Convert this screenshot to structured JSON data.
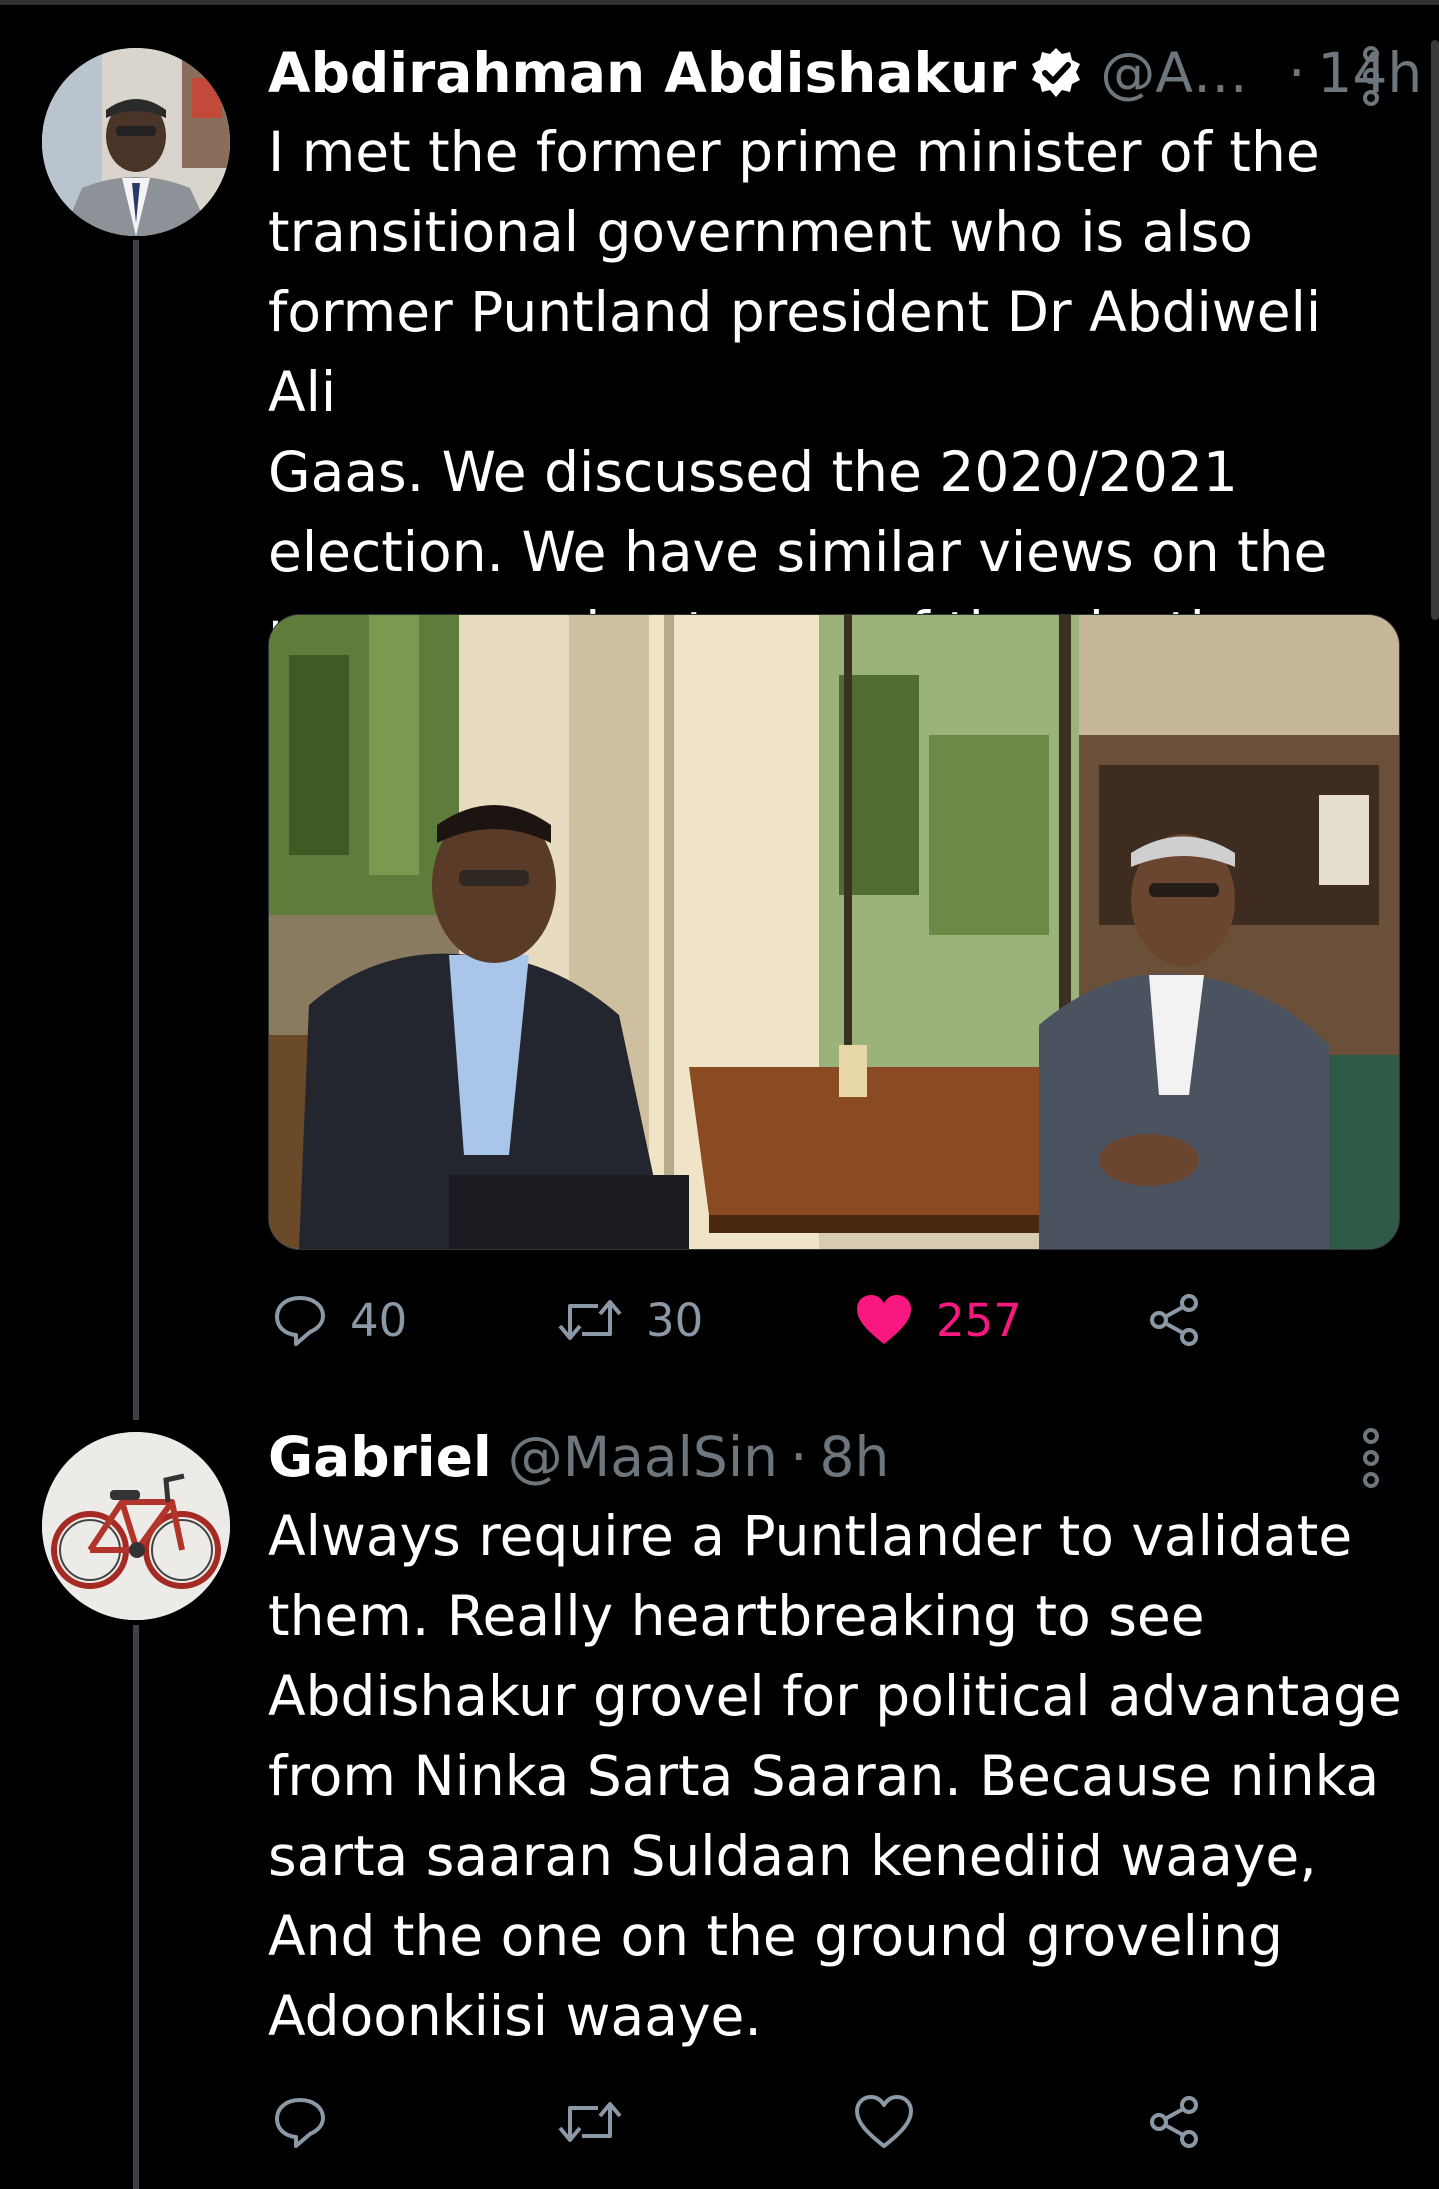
{
  "tweets": [
    {
      "author_name": "Abdirahman Abdishakur",
      "verified": true,
      "handle": "@A…",
      "separator": "·",
      "time": "14h",
      "text": "I met the former prime minister of the\ntransitional government who is also\nformer Puntland president Dr Abdiweli Ali\nGaas. We discussed the 2020/2021\nelection. We have similar views on the\nprocess and outcome of the elections.",
      "has_media": true,
      "actions": {
        "reply_count": "40",
        "retweet_count": "30",
        "like_count": "257",
        "liked": true
      }
    },
    {
      "author_name": "Gabriel",
      "handle": "@MaalSin",
      "separator": "·",
      "time": "8h",
      "text": "Always require a Puntlander  to validate\nthem. Really heartbreaking to see\nAbdishakur grovel for political advantage\nfrom Ninka Sarta Saaran. Because ninka\nsarta saaran Suldaan kenediid waaye,\nAnd the one on the ground groveling\nAdoonkiisi waaye.",
      "has_media": false,
      "actions": {
        "reply_count": "",
        "retweet_count": "",
        "like_count": "",
        "liked": false
      }
    }
  ],
  "icons": {
    "reply": "reply-icon",
    "retweet": "retweet-icon",
    "like": "heart-icon",
    "share": "share-icon",
    "more": "more-options-icon",
    "verified": "verified-badge-icon"
  },
  "colors": {
    "background": "#000000",
    "text": "#ffffff",
    "secondary": "#6e767d",
    "like_active": "#f91880",
    "thread_line": "#3d4248"
  }
}
